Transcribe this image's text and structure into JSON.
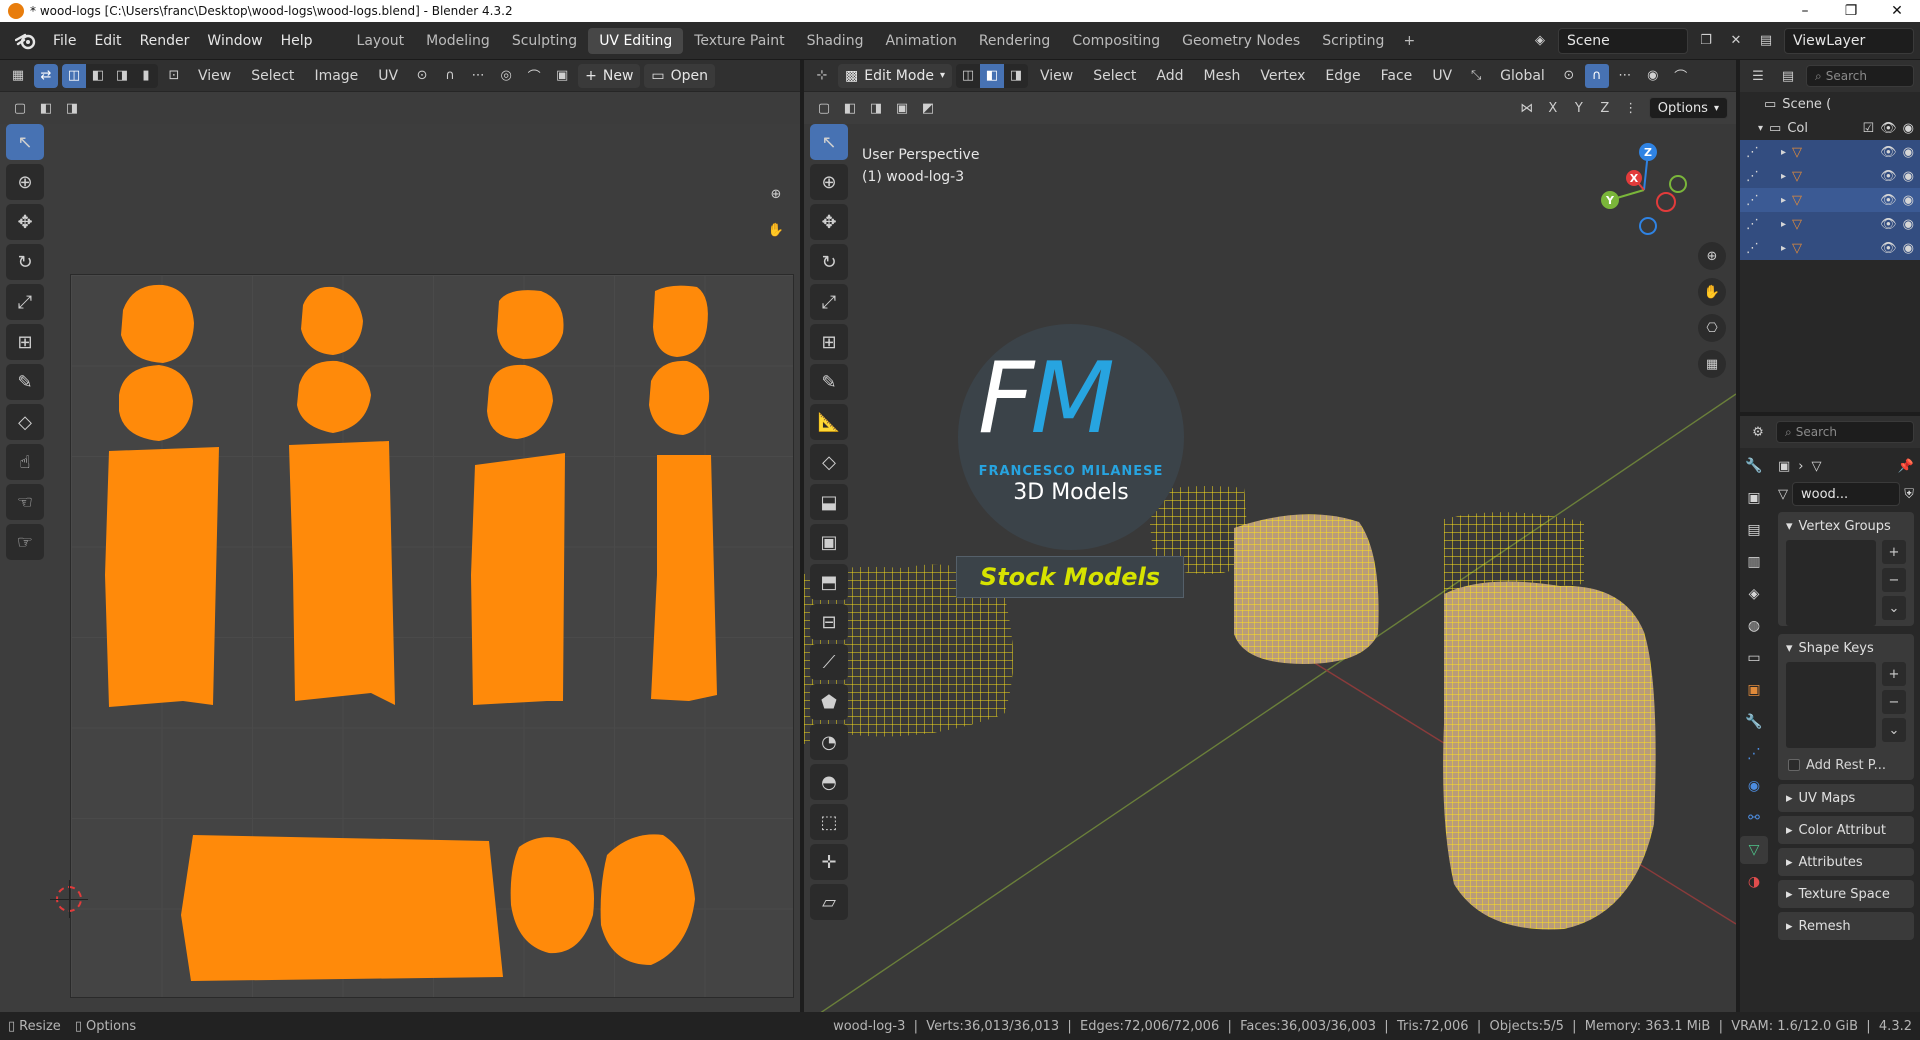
{
  "window": {
    "title": "* wood-logs [C:\\Users\\franc\\Desktop\\wood-logs\\wood-logs.blend] - Blender 4.3.2",
    "controls": [
      "–",
      "❐",
      "✕"
    ]
  },
  "topbar": {
    "menu": [
      "File",
      "Edit",
      "Render",
      "Window",
      "Help"
    ],
    "workspaces": [
      "Layout",
      "Modeling",
      "Sculpting",
      "UV Editing",
      "Texture Paint",
      "Shading",
      "Animation",
      "Rendering",
      "Compositing",
      "Geometry Nodes",
      "Scripting"
    ],
    "active_workspace": "UV Editing",
    "scene": "Scene",
    "view_layer": "ViewLayer"
  },
  "uv_editor": {
    "menus": [
      "View",
      "Select",
      "Image",
      "UV"
    ],
    "new_label": "New",
    "open_label": "Open"
  },
  "view3d": {
    "mode": "Edit Mode",
    "menus": [
      "View",
      "Select",
      "Add",
      "Mesh",
      "Vertex",
      "Edge",
      "Face",
      "UV"
    ],
    "orientation": "Global",
    "options_label": "Options",
    "axes": [
      "X",
      "Y",
      "Z"
    ],
    "overlay_line1": "User Perspective",
    "overlay_line2": "(1) wood-log-3",
    "gizmo_axes": {
      "x": "X",
      "y": "Y",
      "z": "Z"
    }
  },
  "watermark": {
    "monogram_f": "F",
    "monogram_m": "M",
    "name": "FRANCESCO MILANESE",
    "sub": "3D Models",
    "banner": "Stock Models"
  },
  "outliner": {
    "search_placeholder": "Search",
    "scene_label": "Scene (",
    "collection_label": "Col"
  },
  "properties": {
    "search_placeholder": "Search",
    "object_name": "wood...",
    "panels": {
      "vertex_groups": "Vertex Groups",
      "shape_keys": "Shape Keys",
      "add_rest": "Add Rest P...",
      "uv_maps": "UV Maps",
      "color_attributes": "Color Attribut",
      "attributes": "Attributes",
      "texture_space": "Texture Space",
      "remesh": "Remesh"
    }
  },
  "statusbar": {
    "resize": "Resize",
    "options": "Options",
    "stats": "wood-log-3  |  Verts:36,013/36,013  |  Edges:72,006/72,006  |  Faces:36,003/36,003  |  Tris:72,006  |  Objects:5/5  |  Memory: 363.1 MiB  |  VRAM: 1.6/12.0 GiB  |  4.3.2"
  },
  "colors": {
    "uv_island": "#ff8a0a",
    "mesh_wire": "#ffe21a",
    "selection_blue": "#4772b3",
    "accent_banner": "#d7e300"
  }
}
